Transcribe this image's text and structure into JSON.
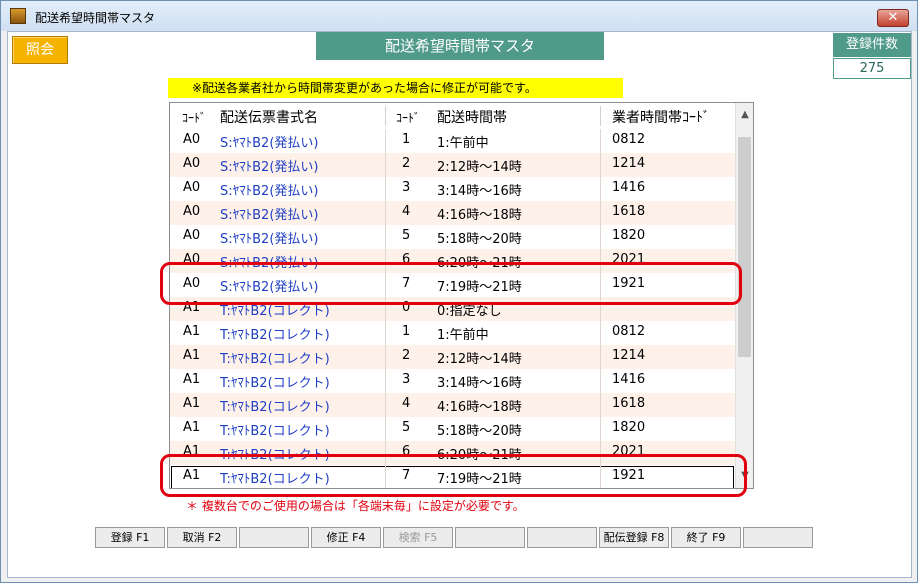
{
  "window": {
    "title": "配送希望時間帯マスタ",
    "close_label": "✕"
  },
  "toolbar": {
    "inquiry_label": "照会"
  },
  "header": {
    "title": "配送希望時間帯マスタ"
  },
  "registered_count": {
    "label": "登録件数",
    "value": "275"
  },
  "notice": "※配送各業者社から時間帯変更があった場合に修正が可能です。",
  "table": {
    "columns": [
      "ｺｰﾄﾞ",
      "配送伝票書式名",
      "ｺｰﾄﾞ",
      "配送時間帯",
      "業者時間帯ｺｰﾄﾞ"
    ],
    "rows": [
      {
        "code": "A0",
        "form": "S:ﾔﾏﾄB2(発払い)",
        "time_code": "1",
        "slot": "1:午前中",
        "vendor_code": "0812"
      },
      {
        "code": "A0",
        "form": "S:ﾔﾏﾄB2(発払い)",
        "time_code": "2",
        "slot": "2:12時～14時",
        "vendor_code": "1214"
      },
      {
        "code": "A0",
        "form": "S:ﾔﾏﾄB2(発払い)",
        "time_code": "3",
        "slot": "3:14時～16時",
        "vendor_code": "1416"
      },
      {
        "code": "A0",
        "form": "S:ﾔﾏﾄB2(発払い)",
        "time_code": "4",
        "slot": "4:16時～18時",
        "vendor_code": "1618"
      },
      {
        "code": "A0",
        "form": "S:ﾔﾏﾄB2(発払い)",
        "time_code": "5",
        "slot": "5:18時～20時",
        "vendor_code": "1820"
      },
      {
        "code": "A0",
        "form": "S:ﾔﾏﾄB2(発払い)",
        "time_code": "6",
        "slot": "6:20時～21時",
        "vendor_code": "2021"
      },
      {
        "code": "A0",
        "form": "S:ﾔﾏﾄB2(発払い)",
        "time_code": "7",
        "slot": "7:19時～21時",
        "vendor_code": "1921"
      },
      {
        "code": "A1",
        "form": "T:ﾔﾏﾄB2(コレクト)",
        "time_code": "0",
        "slot": "0:指定なし",
        "vendor_code": ""
      },
      {
        "code": "A1",
        "form": "T:ﾔﾏﾄB2(コレクト)",
        "time_code": "1",
        "slot": "1:午前中",
        "vendor_code": "0812"
      },
      {
        "code": "A1",
        "form": "T:ﾔﾏﾄB2(コレクト)",
        "time_code": "2",
        "slot": "2:12時～14時",
        "vendor_code": "1214"
      },
      {
        "code": "A1",
        "form": "T:ﾔﾏﾄB2(コレクト)",
        "time_code": "3",
        "slot": "3:14時～16時",
        "vendor_code": "1416"
      },
      {
        "code": "A1",
        "form": "T:ﾔﾏﾄB2(コレクト)",
        "time_code": "4",
        "slot": "4:16時～18時",
        "vendor_code": "1618"
      },
      {
        "code": "A1",
        "form": "T:ﾔﾏﾄB2(コレクト)",
        "time_code": "5",
        "slot": "5:18時～20時",
        "vendor_code": "1820"
      },
      {
        "code": "A1",
        "form": "T:ﾔﾏﾄB2(コレクト)",
        "time_code": "6",
        "slot": "6:20時～21時",
        "vendor_code": "2021"
      },
      {
        "code": "A1",
        "form": "T:ﾔﾏﾄB2(コレクト)",
        "time_code": "7",
        "slot": "7:19時～21時",
        "vendor_code": "1921"
      }
    ]
  },
  "footnote": "＊ 複数台でのご使用の場合は「各端末毎」に設定が必要です。",
  "function_keys": [
    {
      "label": "登録 F1",
      "enabled": true
    },
    {
      "label": "取消 F2",
      "enabled": true
    },
    {
      "label": "",
      "enabled": true
    },
    {
      "label": "修正 F4",
      "enabled": true
    },
    {
      "label": "検索 F5",
      "enabled": false
    },
    {
      "label": "",
      "enabled": true
    },
    {
      "label": "",
      "enabled": true
    },
    {
      "label": "配伝登録 F8",
      "enabled": true
    },
    {
      "label": "終了 F9",
      "enabled": true
    },
    {
      "label": "",
      "enabled": true
    }
  ],
  "colors": {
    "accent": "#4f9a88",
    "highlight": "#e0000e",
    "notice_bg": "#ffff00",
    "inquiry_bg": "#f5b300"
  }
}
